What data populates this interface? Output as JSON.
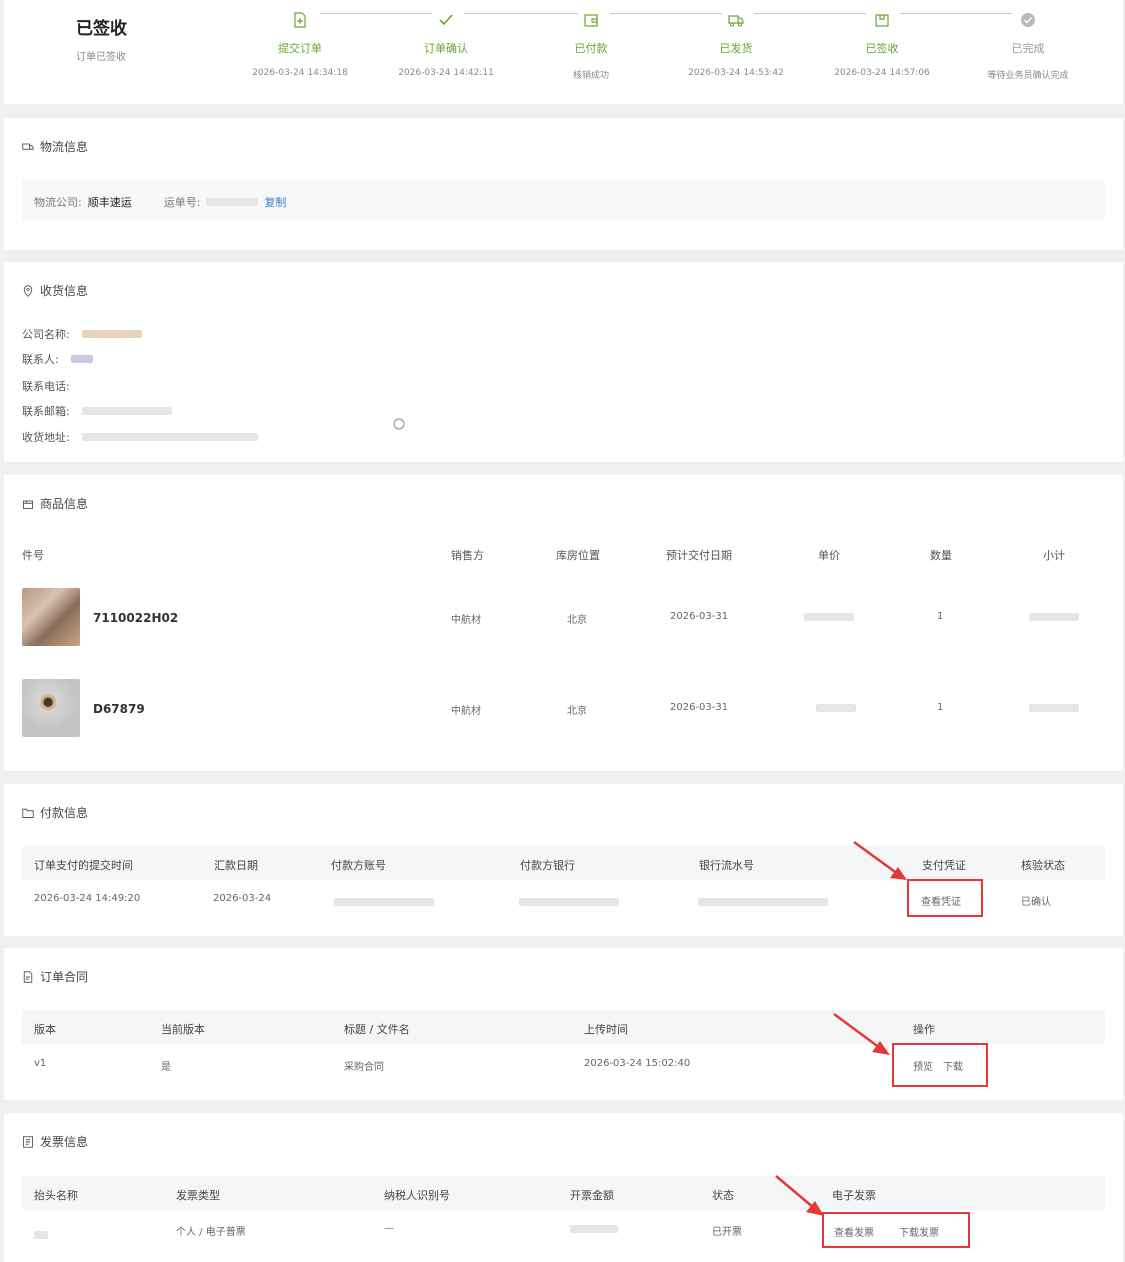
{
  "header": {
    "status_title": "已签收",
    "status_sub": "订单已签收",
    "steps": [
      {
        "label": "提交订单",
        "time": "2026-03-24 14:34:18",
        "icon": "doc-plus-icon"
      },
      {
        "label": "订单确认",
        "time": "2026-03-24 14:42:11",
        "icon": "check-icon"
      },
      {
        "label": "已付款",
        "time": "核销成功",
        "icon": "wallet-icon"
      },
      {
        "label": "已发货",
        "time": "2026-03-24 14:53:42",
        "icon": "truck-icon"
      },
      {
        "label": "已签收",
        "time": "2026-03-24 14:57:06",
        "icon": "package-icon"
      },
      {
        "label": "已完成",
        "time": "等待业务员确认完成",
        "icon": "check-circle-icon"
      }
    ]
  },
  "logistics": {
    "title": "物流信息",
    "company_label": "物流公司:",
    "company": "顺丰速运",
    "waybill_label": "运单号:",
    "copy": "复制"
  },
  "receiver": {
    "title": "收货信息",
    "company_label": "公司名称:",
    "contact_label": "联系人:",
    "phone_label": "联系电话:",
    "email_label": "联系邮箱:",
    "address_label": "收货地址:"
  },
  "products": {
    "title": "商品信息",
    "headers": [
      "件号",
      "销售方",
      "库房位置",
      "预计交付日期",
      "单价",
      "数量",
      "小计"
    ],
    "items": [
      {
        "part": "7110022H02",
        "seller": "中航材",
        "location": "北京",
        "date": "2026-03-31",
        "qty": "1"
      },
      {
        "part": "D67879",
        "seller": "中航材",
        "location": "北京",
        "date": "2026-03-31",
        "qty": "1"
      }
    ]
  },
  "payment": {
    "title": "付款信息",
    "headers": [
      "订单支付的提交时间",
      "汇款日期",
      "付款方账号",
      "付款方银行",
      "银行流水号",
      "支付凭证",
      "核验状态"
    ],
    "row": {
      "submit_time": "2026-03-24 14:49:20",
      "date": "2026-03-24",
      "voucher": "查看凭证",
      "status": "已确认"
    }
  },
  "contract": {
    "title": "订单合同",
    "headers": [
      "版本",
      "当前版本",
      "标题 / 文件名",
      "上传时间",
      "操作"
    ],
    "row": {
      "version": "v1",
      "current": "是",
      "name": "采购合同",
      "time": "2026-03-24 15:02:40",
      "preview": "预览",
      "download": "下载"
    }
  },
  "invoice": {
    "title": "发票信息",
    "headers": [
      "抬头名称",
      "发票类型",
      "纳税人识别号",
      "开票金额",
      "状态",
      "电子发票"
    ],
    "row": {
      "type": "个人 / 电子普票",
      "tax_id": "—",
      "status": "已开票",
      "view": "查看发票",
      "download": "下载发票"
    }
  },
  "colors": {
    "accent": "#6aa530",
    "link": "#3b82c4",
    "highlight": "#e53935"
  }
}
